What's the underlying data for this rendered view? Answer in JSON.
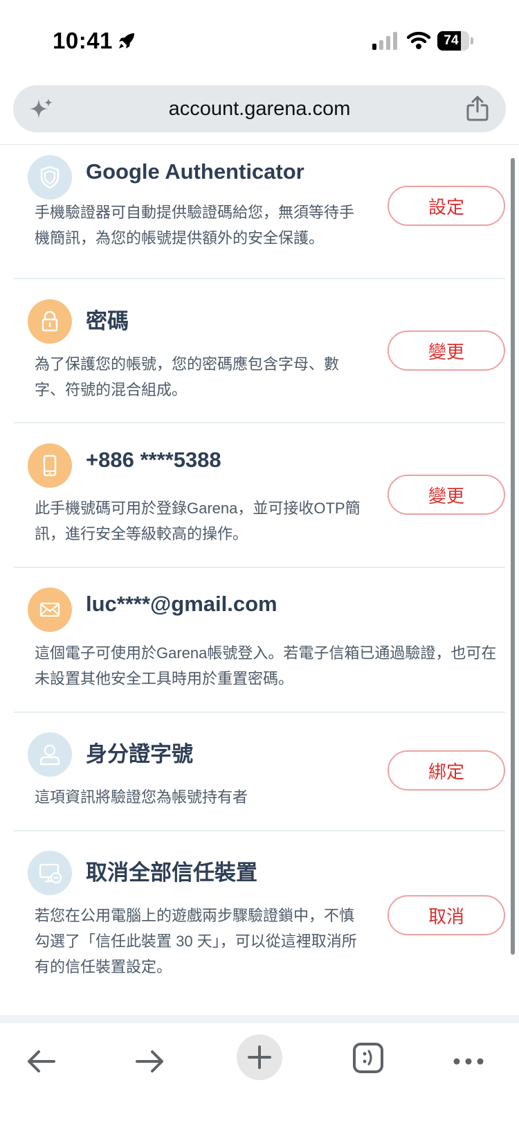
{
  "status": {
    "time": "10:41",
    "battery": "74",
    "battery_level_percent": 74
  },
  "browser": {
    "url": "account.garena.com"
  },
  "sections": [
    {
      "title": "Google Authenticator",
      "description": "手機驗證器可自動提供驗證碼給您，無須等待手機簡訊，為您的帳號提供額外的安全保護。",
      "button": "設定",
      "icon": "shield-icon"
    },
    {
      "title": "密碼",
      "description": "為了保護您的帳號，您的密碼應包含字母、數字、符號的混合組成。",
      "button": "變更",
      "icon": "lock-icon"
    },
    {
      "title": "+886 ****5388",
      "description": "此手機號碼可用於登錄Garena，並可接收OTP簡訊，進行安全等級較高的操作。",
      "button": "變更",
      "icon": "phone-icon"
    },
    {
      "title": "luc****@gmail.com",
      "description": "這個電子可使用於Garena帳號登入。若電子信箱已通過驗證，也可在未設置其他安全工具時用於重置密碼。",
      "icon": "envelope-icon"
    },
    {
      "title": "身分證字號",
      "description": "這項資訊將驗證您為帳號持有者",
      "button": "綁定",
      "icon": "id-person-icon"
    },
    {
      "title": "取消全部信任裝置",
      "description": "若您在公用電腦上的遊戲兩步驟驗證鎖中，不慎勾選了「信任此裝置 30 天」，可以從這裡取消所有的信任裝置設定。",
      "button": "取消",
      "icon": "device-remove-icon"
    }
  ],
  "toolbar": {
    "tabs_icon": ":)"
  },
  "colors": {
    "accent_red": "#d9302f",
    "icon_orange": "#f8c17f",
    "icon_blue": "#d8e6ef",
    "title_text": "#2e3e55"
  }
}
